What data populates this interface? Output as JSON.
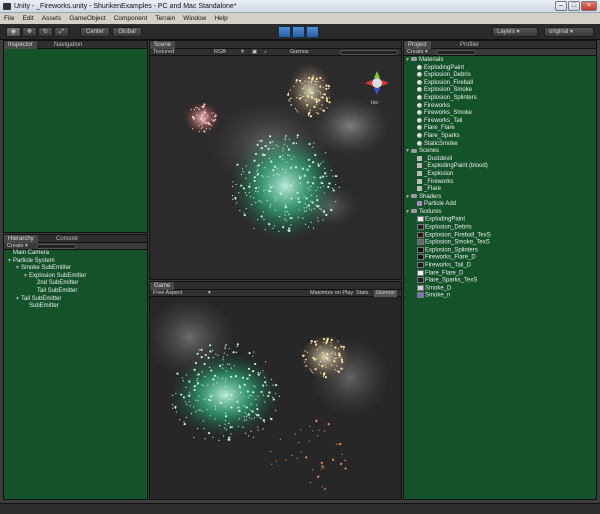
{
  "title": "Unity - _Fireworks.unity - ShurikenExamples - PC and Mac Standalone*",
  "menu": [
    "File",
    "Edit",
    "Assets",
    "GameObject",
    "Component",
    "Terrain",
    "Window",
    "Help"
  ],
  "toolbar": {
    "center": "Center",
    "global": "Global",
    "layers": "Layers",
    "layout": "original"
  },
  "inspector": {
    "tab1": "Inspector",
    "tab2": "Navigation"
  },
  "scene": {
    "tab": "Scene",
    "shading": "Textured",
    "rgb": "RGB",
    "gizmos": "Gizmos",
    "persp": "Iso"
  },
  "game": {
    "tab": "Game",
    "aspect": "Free Aspect",
    "maximize": "Maximize on Play",
    "stats": "Stats",
    "gizmos": "Gizmos"
  },
  "hierarchy": {
    "tab1": "Hierarchy",
    "tab2": "Console",
    "create": "Create",
    "items": [
      {
        "label": "Main Camera",
        "indent": 0,
        "tri": ""
      },
      {
        "label": "Particle System",
        "indent": 0,
        "tri": "▼"
      },
      {
        "label": "Smoke SubEmitter",
        "indent": 1,
        "tri": "▼"
      },
      {
        "label": "Explosion SubEmitter",
        "indent": 2,
        "tri": "▼"
      },
      {
        "label": "2nd SubEmitter",
        "indent": 3,
        "tri": ""
      },
      {
        "label": "Tail SubEmitter",
        "indent": 3,
        "tri": ""
      },
      {
        "label": "Tail SubEmitter",
        "indent": 1,
        "tri": "▼"
      },
      {
        "label": "SubEmitter",
        "indent": 2,
        "tri": ""
      }
    ]
  },
  "project": {
    "tab1": "Project",
    "tab2": "Profiler",
    "create": "Create",
    "items": [
      {
        "label": "Materials",
        "type": "folder",
        "indent": 0
      },
      {
        "label": "ExplodingPaint",
        "type": "mat",
        "indent": 1
      },
      {
        "label": "Explosion_Debris",
        "type": "mat",
        "indent": 1
      },
      {
        "label": "Explosion_Fireball",
        "type": "mat",
        "indent": 1
      },
      {
        "label": "Explosion_Smoke",
        "type": "mat",
        "indent": 1
      },
      {
        "label": "Explosion_Splinters",
        "type": "mat",
        "indent": 1
      },
      {
        "label": "Fireworks",
        "type": "mat",
        "indent": 1
      },
      {
        "label": "Fireworks_Smoke",
        "type": "mat",
        "indent": 1
      },
      {
        "label": "Fireworks_Tail",
        "type": "mat",
        "indent": 1
      },
      {
        "label": "Flare_Flare",
        "type": "mat",
        "indent": 1
      },
      {
        "label": "Flare_Sparks",
        "type": "mat",
        "indent": 1
      },
      {
        "label": "StaticSmoke",
        "type": "mat",
        "indent": 1
      },
      {
        "label": "Scenes",
        "type": "folder",
        "indent": 0
      },
      {
        "label": "_Dustdevil",
        "type": "scene",
        "indent": 1
      },
      {
        "label": "_ExplodingPaint (blood)",
        "type": "scene",
        "indent": 1
      },
      {
        "label": "_Explosion",
        "type": "scene",
        "indent": 1
      },
      {
        "label": "_Fireworks",
        "type": "scene",
        "indent": 1
      },
      {
        "label": "_Flare",
        "type": "scene",
        "indent": 1
      },
      {
        "label": "Shaders",
        "type": "folder",
        "indent": 0
      },
      {
        "label": "Particle Add",
        "type": "shader",
        "indent": 1
      },
      {
        "label": "Textures",
        "type": "folder",
        "indent": 0
      },
      {
        "label": "ExplodingPaint",
        "type": "tex",
        "indent": 1,
        "color": "#e8e8e8"
      },
      {
        "label": "Explosion_Debris",
        "type": "tex",
        "indent": 1,
        "color": "#222222"
      },
      {
        "label": "Explosion_Fireball_TexS",
        "type": "tex",
        "indent": 1,
        "color": "#331111"
      },
      {
        "label": "Explosion_Smoke_TexS",
        "type": "tex",
        "indent": 1,
        "color": "#666666"
      },
      {
        "label": "Explosion_Splinters",
        "type": "tex",
        "indent": 1,
        "color": "#111111"
      },
      {
        "label": "Fireworks_Flare_D",
        "type": "tex",
        "indent": 1,
        "color": "#101010"
      },
      {
        "label": "Fireworks_Tail_D",
        "type": "tex",
        "indent": 1,
        "color": "#181818"
      },
      {
        "label": "Flare_Flare_D",
        "type": "tex",
        "indent": 1,
        "color": "#f0f0f0"
      },
      {
        "label": "Flare_Sparks_TexS",
        "type": "tex",
        "indent": 1,
        "color": "#202020"
      },
      {
        "label": "Smoke_D",
        "type": "tex",
        "indent": 1,
        "color": "#d0d0e0"
      },
      {
        "label": "Smoke_n",
        "type": "tex",
        "indent": 1,
        "color": "#7a74d8"
      }
    ]
  }
}
